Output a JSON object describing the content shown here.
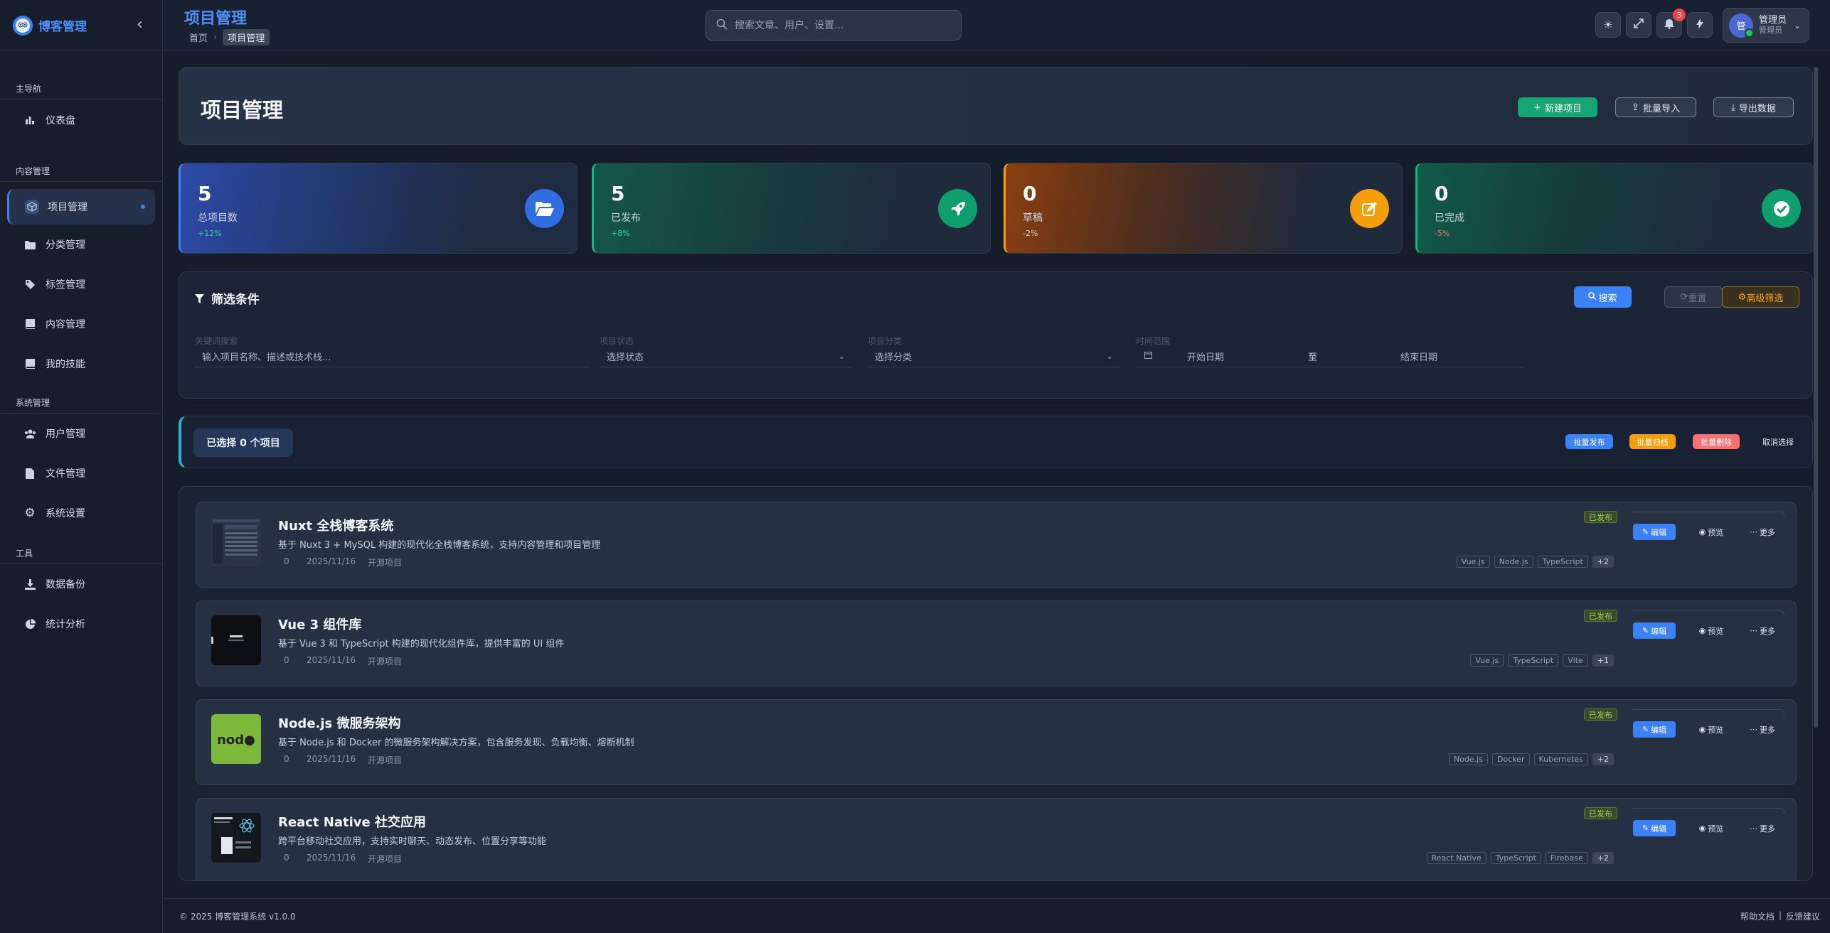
{
  "brand": {
    "title": "博客管理",
    "logo_icon": "owl-logo-icon"
  },
  "sidebar": {
    "groups": [
      {
        "label": "主导航",
        "items": [
          {
            "label": "仪表盘",
            "icon": "bar-chart-icon"
          }
        ]
      },
      {
        "label": "内容管理",
        "items": [
          {
            "label": "项目管理",
            "icon": "cube-icon",
            "active": true
          },
          {
            "label": "分类管理",
            "icon": "folder-icon"
          },
          {
            "label": "标签管理",
            "icon": "tags-icon"
          },
          {
            "label": "内容管理",
            "icon": "book-icon"
          },
          {
            "label": "我的技能",
            "icon": "book-icon"
          }
        ]
      },
      {
        "label": "系统管理",
        "items": [
          {
            "label": "用户管理",
            "icon": "users-icon"
          },
          {
            "label": "文件管理",
            "icon": "file-icon"
          },
          {
            "label": "系统设置",
            "icon": "gear-icon"
          }
        ]
      },
      {
        "label": "工具",
        "items": [
          {
            "label": "数据备份",
            "icon": "download-icon"
          },
          {
            "label": "统计分析",
            "icon": "pie-chart-icon"
          }
        ]
      }
    ]
  },
  "topbar": {
    "title": "项目管理",
    "breadcrumb": [
      "首页",
      "项目管理"
    ],
    "search_placeholder": "搜索文章、用户、设置...",
    "notifications": "3",
    "user_name": "管理员",
    "user_role": "管理员",
    "avatar_text": "管"
  },
  "header": {
    "title": "项目管理",
    "new_label": "新建项目",
    "import_label": "批量导入",
    "export_label": "导出数据"
  },
  "stats": [
    {
      "value": "5",
      "label": "总项目数",
      "trend": "+12%",
      "trend_color": "#34d399",
      "icon": "folder-open-icon"
    },
    {
      "value": "5",
      "label": "已发布",
      "trend": "+8%",
      "trend_color": "#34d399",
      "icon": "rocket-icon"
    },
    {
      "value": "0",
      "label": "草稿",
      "trend": "-2%",
      "trend_color": "#cbd5e1",
      "icon": "edit-icon"
    },
    {
      "value": "0",
      "label": "已完成",
      "trend": "-5%",
      "trend_color": "#f87171",
      "icon": "check-circle-icon"
    }
  ],
  "filter": {
    "title": "筛选条件",
    "search_label": "搜索",
    "reset_label": "重置",
    "advanced_label": "高级筛选",
    "keyword_label": "关键词搜索",
    "keyword_placeholder": "输入项目名称、描述或技术栈...",
    "status_label": "项目状态",
    "status_placeholder": "选择状态",
    "category_label": "项目分类",
    "category_placeholder": "选择分类",
    "time_label": "时间范围",
    "start_placeholder": "开始日期",
    "to_label": "至",
    "end_placeholder": "结束日期"
  },
  "selection": {
    "selected_text": "已选择 0 个项目",
    "publish_label": "批量发布",
    "archive_label": "批量归档",
    "delete_label": "批量删除",
    "cancel_label": "取消选择"
  },
  "projects": [
    {
      "title": "Nuxt 全栈博客系统",
      "desc": "基于 Nuxt 3 + MySQL 构建的现代化全栈博客系统，支持内容管理和项目管理",
      "views": "0",
      "date": "2025/11/16",
      "type": "开源项目",
      "status": "已发布",
      "tags": [
        "Vue.js",
        "Node.js",
        "TypeScript"
      ],
      "more": "+2",
      "thumb": "dashboard"
    },
    {
      "title": "Vue 3 组件库",
      "desc": "基于 Vue 3 和 TypeScript 构建的现代化组件库，提供丰富的 UI 组件",
      "views": "0",
      "date": "2025/11/16",
      "type": "开源项目",
      "status": "已发布",
      "tags": [
        "Vue.js",
        "TypeScript",
        "Vite"
      ],
      "more": "+1",
      "thumb": "dark"
    },
    {
      "title": "Node.js 微服务架构",
      "desc": "基于 Node.js 和 Docker 的微服务架构解决方案，包含服务发现、负载均衡、熔断机制",
      "views": "0",
      "date": "2025/11/16",
      "type": "开源项目",
      "status": "已发布",
      "tags": [
        "Node.js",
        "Docker",
        "Kubernetes"
      ],
      "more": "+2",
      "thumb": "node"
    },
    {
      "title": "React Native 社交应用",
      "desc": "跨平台移动社交应用，支持实时聊天、动态发布、位置分享等功能",
      "views": "0",
      "date": "2025/11/16",
      "type": "开源项目",
      "status": "已发布",
      "tags": [
        "React Native",
        "TypeScript",
        "Firebase"
      ],
      "more": "+2",
      "thumb": "react"
    }
  ],
  "actions": {
    "edit": "编辑",
    "preview": "预览",
    "more": "更多"
  },
  "footer": {
    "copyright": "© 2025 博客管理系统 v1.0.0",
    "help": "帮助文档",
    "sep": "|",
    "feedback": "反馈建议"
  },
  "colors": {
    "accent": "#3b82f6",
    "success": "#16a574",
    "warning": "#f59e0b",
    "danger": "#f87171"
  }
}
